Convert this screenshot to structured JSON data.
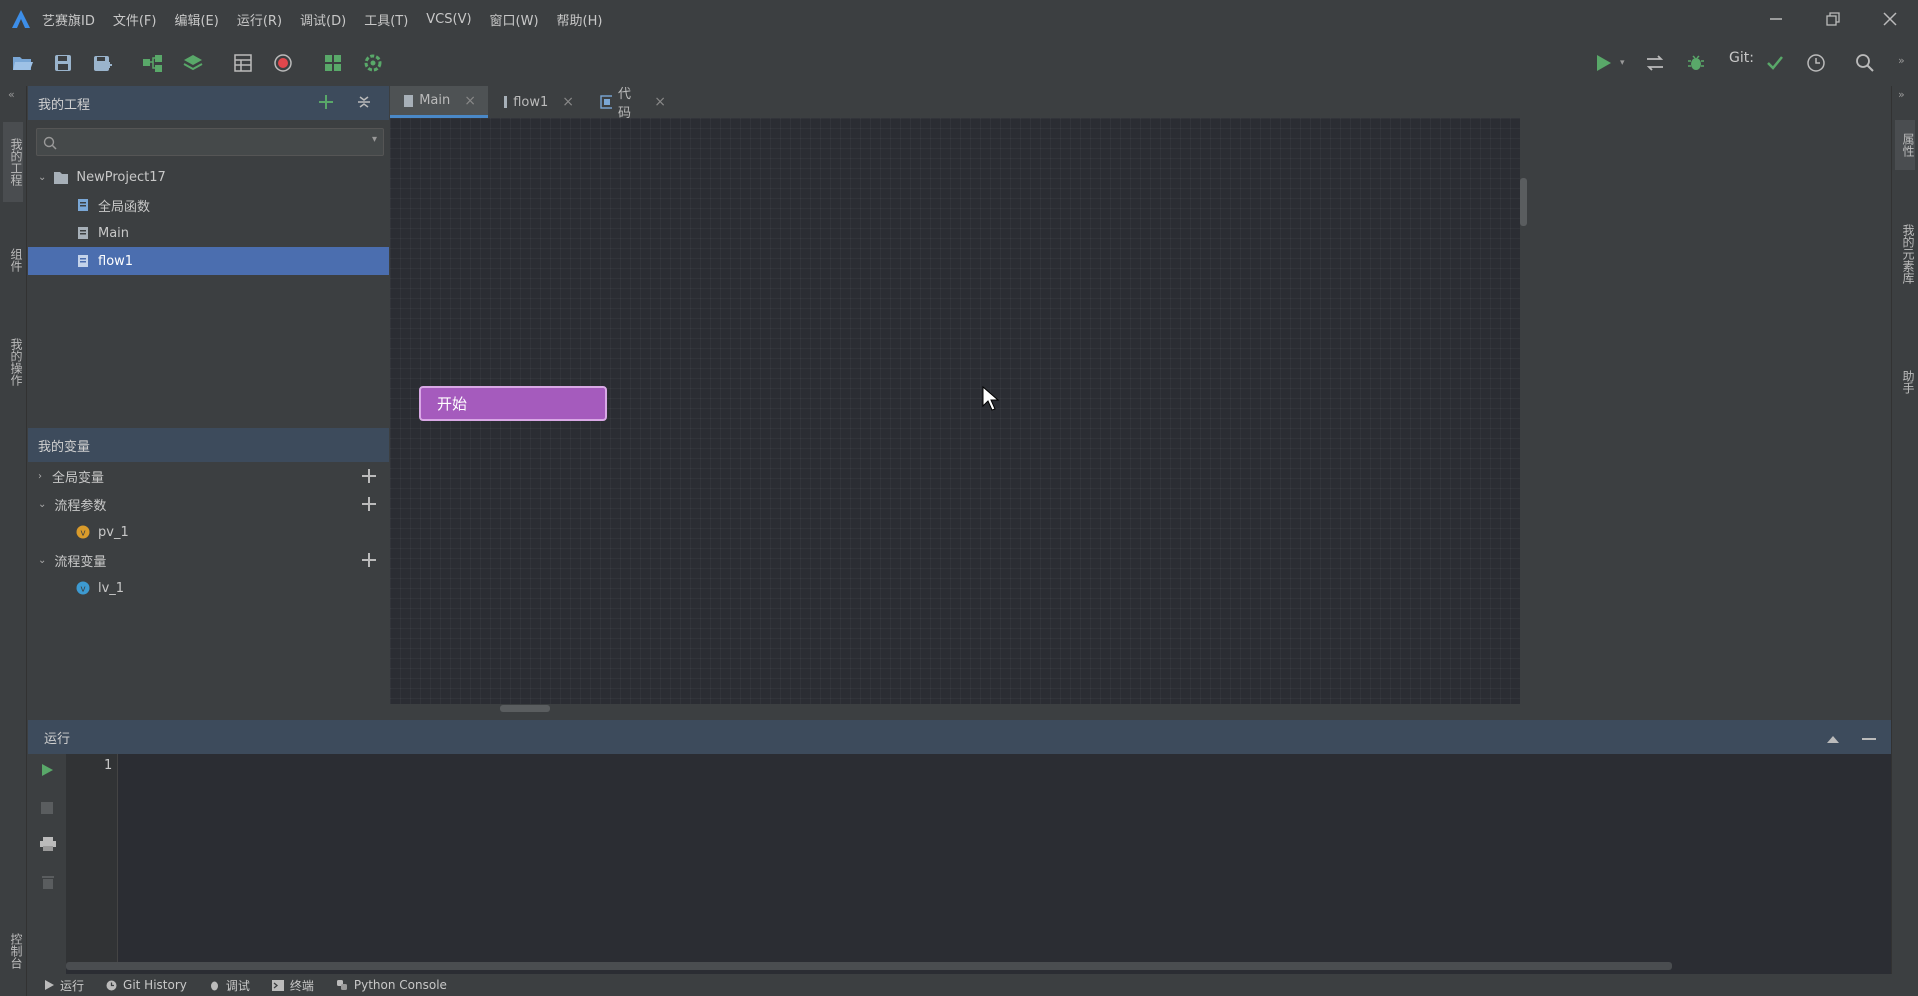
{
  "app": {
    "menu": [
      "艺赛旗ID",
      "文件(F)",
      "编辑(E)",
      "运行(R)",
      "调试(D)",
      "工具(T)",
      "VCS(V)",
      "窗口(W)",
      "帮助(H)"
    ]
  },
  "toolbar": {
    "git_label": "Git:"
  },
  "left_strip": {
    "tab1": "我的工程",
    "tab2": "组件",
    "tab3": "我的操作",
    "tab4": "控制台"
  },
  "right_strip": {
    "tab1": "属性",
    "tab2": "我的元素库",
    "tab3": "助手"
  },
  "project": {
    "title": "我的工程",
    "root": "NewProject17",
    "items": [
      "全局函数",
      "Main",
      "flow1"
    ],
    "selected": "flow1"
  },
  "vars": {
    "title": "我的变量",
    "global": "全局变量",
    "params": "流程参数",
    "param_item": "pv_1",
    "locals": "流程变量",
    "local_item": "lv_1"
  },
  "editor": {
    "tabs": [
      "Main",
      "flow1",
      "代码"
    ],
    "active_tab": "Main",
    "start_node": "开始"
  },
  "run": {
    "title": "运行",
    "line_number": "1"
  },
  "bottom_tabs": [
    "运行",
    "Git History",
    "调试",
    "终端",
    "Python Console"
  ],
  "colors": {
    "accent": "#4b6eaf",
    "start_node": "#a55bbd",
    "run_green": "#59a869",
    "record_red": "#e0474c"
  }
}
